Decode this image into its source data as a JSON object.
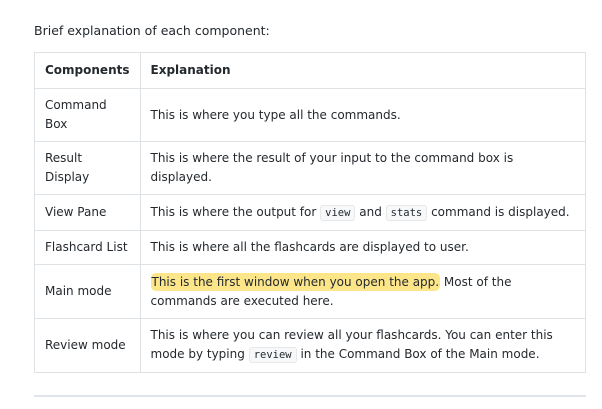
{
  "intro": "Brief explanation of each component:",
  "headers": [
    "Components",
    "Explanation"
  ],
  "rows": [
    {
      "component": "Command Box",
      "explanation": "This is where you type all the commands."
    },
    {
      "component": "Result Display",
      "explanation": "This is where the result of your input to the command box is displayed."
    },
    {
      "component": "View Pane",
      "pre": "This is where the output for ",
      "code1": "view",
      "mid": " and ",
      "code2": "stats",
      "post": " command is displayed."
    },
    {
      "component": "Flashcard List",
      "explanation": "This is where all the flashcards are displayed to user."
    },
    {
      "component": "Main mode",
      "highlight": "This is the first window when you open the app.",
      "post": " Most of the commands are executed here."
    },
    {
      "component": "Review mode",
      "pre": "This is where you can review all your flashcards. You can enter this mode by typing ",
      "code1": "review",
      "post": " in the Command Box of the Main mode."
    }
  ],
  "colors": {
    "highlight": "#fde68a",
    "border": "#dfe2e5"
  }
}
